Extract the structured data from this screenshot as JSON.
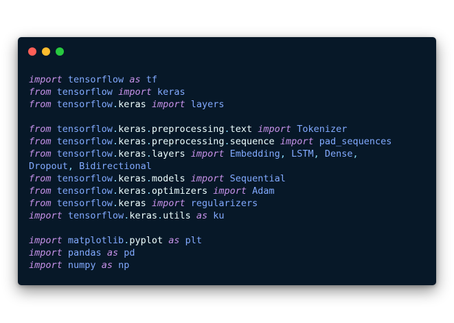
{
  "window": {
    "background": "#071828",
    "controls": {
      "close_color": "#ff5f57",
      "minimize_color": "#febc2e",
      "maximize_color": "#28c840"
    }
  },
  "colors": {
    "keyword": "#c792ea",
    "module": "#82aaff",
    "attribute": "#eeffff",
    "punctuation": "#89ddff",
    "plain": "#82aaff"
  },
  "code_lines": [
    [
      {
        "t": "import",
        "c": "keyword"
      },
      {
        "t": " tensorflow ",
        "c": "module"
      },
      {
        "t": "as",
        "c": "keyword"
      },
      {
        "t": " tf",
        "c": "module"
      }
    ],
    [
      {
        "t": "from",
        "c": "keyword"
      },
      {
        "t": " tensorflow ",
        "c": "module"
      },
      {
        "t": "import",
        "c": "keyword"
      },
      {
        "t": " keras",
        "c": "module"
      }
    ],
    [
      {
        "t": "from",
        "c": "keyword"
      },
      {
        "t": " tensorflow",
        "c": "module"
      },
      {
        "t": ".",
        "c": "punctuation"
      },
      {
        "t": "keras ",
        "c": "attribute"
      },
      {
        "t": "import",
        "c": "keyword"
      },
      {
        "t": " layers",
        "c": "module"
      }
    ],
    [],
    [
      {
        "t": "from",
        "c": "keyword"
      },
      {
        "t": " tensorflow",
        "c": "module"
      },
      {
        "t": ".",
        "c": "punctuation"
      },
      {
        "t": "keras",
        "c": "attribute"
      },
      {
        "t": ".",
        "c": "punctuation"
      },
      {
        "t": "preprocessing",
        "c": "attribute"
      },
      {
        "t": ".",
        "c": "punctuation"
      },
      {
        "t": "text ",
        "c": "attribute"
      },
      {
        "t": "import",
        "c": "keyword"
      },
      {
        "t": " Tokenizer",
        "c": "module"
      }
    ],
    [
      {
        "t": "from",
        "c": "keyword"
      },
      {
        "t": " tensorflow",
        "c": "module"
      },
      {
        "t": ".",
        "c": "punctuation"
      },
      {
        "t": "keras",
        "c": "attribute"
      },
      {
        "t": ".",
        "c": "punctuation"
      },
      {
        "t": "preprocessing",
        "c": "attribute"
      },
      {
        "t": ".",
        "c": "punctuation"
      },
      {
        "t": "sequence ",
        "c": "attribute"
      },
      {
        "t": "import",
        "c": "keyword"
      },
      {
        "t": " pad_sequences",
        "c": "module"
      }
    ],
    [
      {
        "t": "from",
        "c": "keyword"
      },
      {
        "t": " tensorflow",
        "c": "module"
      },
      {
        "t": ".",
        "c": "punctuation"
      },
      {
        "t": "keras",
        "c": "attribute"
      },
      {
        "t": ".",
        "c": "punctuation"
      },
      {
        "t": "layers ",
        "c": "attribute"
      },
      {
        "t": "import",
        "c": "keyword"
      },
      {
        "t": " Embedding",
        "c": "module"
      },
      {
        "t": ",",
        "c": "punctuation"
      },
      {
        "t": " LSTM",
        "c": "module"
      },
      {
        "t": ",",
        "c": "punctuation"
      },
      {
        "t": " Dense",
        "c": "module"
      },
      {
        "t": ",",
        "c": "punctuation"
      }
    ],
    [
      {
        "t": "Dropout",
        "c": "module"
      },
      {
        "t": ",",
        "c": "punctuation"
      },
      {
        "t": " Bidirectional",
        "c": "module"
      }
    ],
    [
      {
        "t": "from",
        "c": "keyword"
      },
      {
        "t": " tensorflow",
        "c": "module"
      },
      {
        "t": ".",
        "c": "punctuation"
      },
      {
        "t": "keras",
        "c": "attribute"
      },
      {
        "t": ".",
        "c": "punctuation"
      },
      {
        "t": "models ",
        "c": "attribute"
      },
      {
        "t": "import",
        "c": "keyword"
      },
      {
        "t": " Sequential",
        "c": "module"
      }
    ],
    [
      {
        "t": "from",
        "c": "keyword"
      },
      {
        "t": " tensorflow",
        "c": "module"
      },
      {
        "t": ".",
        "c": "punctuation"
      },
      {
        "t": "keras",
        "c": "attribute"
      },
      {
        "t": ".",
        "c": "punctuation"
      },
      {
        "t": "optimizers ",
        "c": "attribute"
      },
      {
        "t": "import",
        "c": "keyword"
      },
      {
        "t": " Adam",
        "c": "module"
      }
    ],
    [
      {
        "t": "from",
        "c": "keyword"
      },
      {
        "t": " tensorflow",
        "c": "module"
      },
      {
        "t": ".",
        "c": "punctuation"
      },
      {
        "t": "keras ",
        "c": "attribute"
      },
      {
        "t": "import",
        "c": "keyword"
      },
      {
        "t": " regularizers",
        "c": "module"
      }
    ],
    [
      {
        "t": "import",
        "c": "keyword"
      },
      {
        "t": " tensorflow",
        "c": "module"
      },
      {
        "t": ".",
        "c": "punctuation"
      },
      {
        "t": "keras",
        "c": "attribute"
      },
      {
        "t": ".",
        "c": "punctuation"
      },
      {
        "t": "utils ",
        "c": "attribute"
      },
      {
        "t": "as",
        "c": "keyword"
      },
      {
        "t": " ku",
        "c": "module"
      }
    ],
    [],
    [
      {
        "t": "import",
        "c": "keyword"
      },
      {
        "t": " matplotlib",
        "c": "module"
      },
      {
        "t": ".",
        "c": "punctuation"
      },
      {
        "t": "pyplot ",
        "c": "attribute"
      },
      {
        "t": "as",
        "c": "keyword"
      },
      {
        "t": " plt",
        "c": "module"
      }
    ],
    [
      {
        "t": "import",
        "c": "keyword"
      },
      {
        "t": " pandas ",
        "c": "module"
      },
      {
        "t": "as",
        "c": "keyword"
      },
      {
        "t": " pd",
        "c": "module"
      }
    ],
    [
      {
        "t": "import",
        "c": "keyword"
      },
      {
        "t": " numpy ",
        "c": "module"
      },
      {
        "t": "as",
        "c": "keyword"
      },
      {
        "t": " np",
        "c": "module"
      }
    ]
  ]
}
